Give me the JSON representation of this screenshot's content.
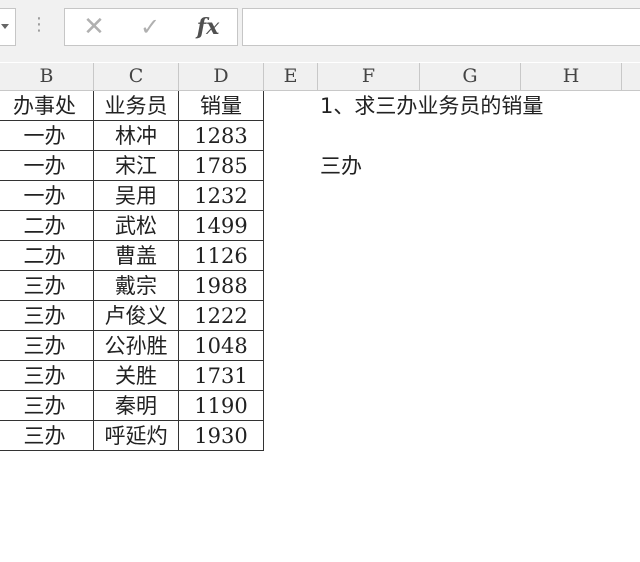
{
  "formula_bar": {
    "icons": {
      "cancel": "close-icon",
      "confirm": "check-icon",
      "function": "fx-icon"
    },
    "fx_label": "fx",
    "cancel_glyph": "✕",
    "confirm_glyph": "✓",
    "formula_value": ""
  },
  "columns": [
    "B",
    "C",
    "D",
    "E",
    "F",
    "G",
    "H"
  ],
  "table": {
    "headers": [
      "办事处",
      "业务员",
      "销量"
    ],
    "rows": [
      [
        "一办",
        "林冲",
        "1283"
      ],
      [
        "一办",
        "宋江",
        "1785"
      ],
      [
        "一办",
        "吴用",
        "1232"
      ],
      [
        "二办",
        "武松",
        "1499"
      ],
      [
        "二办",
        "曹盖",
        "1126"
      ],
      [
        "三办",
        "戴宗",
        "1988"
      ],
      [
        "三办",
        "卢俊义",
        "1222"
      ],
      [
        "三办",
        "公孙胜",
        "1048"
      ],
      [
        "三办",
        "关胜",
        "1731"
      ],
      [
        "三办",
        "秦明",
        "1190"
      ],
      [
        "三办",
        "呼延灼",
        "1930"
      ]
    ]
  },
  "notes": {
    "question": "1、求三办业务员的销量",
    "criteria": "三办"
  }
}
